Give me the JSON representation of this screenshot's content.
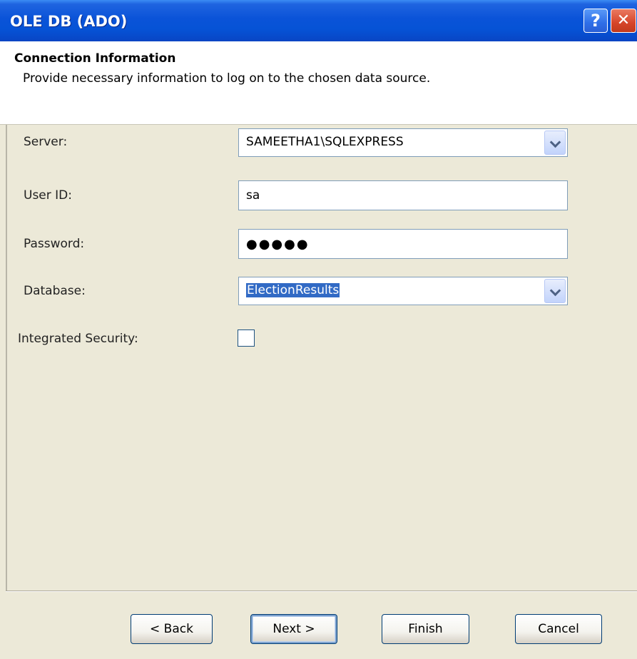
{
  "window": {
    "title": "OLE DB (ADO)",
    "help_label": "?",
    "close_label": "✕"
  },
  "header": {
    "title": "Connection Information",
    "subtitle": "Provide necessary information to log on to the chosen data source."
  },
  "form": {
    "server": {
      "label": "Server:",
      "value": "SAMEETHA1\\SQLEXPRESS"
    },
    "user_id": {
      "label": "User ID:",
      "value": "sa"
    },
    "password": {
      "label": "Password:",
      "value": "●●●●●"
    },
    "database": {
      "label": "Database:",
      "value": "ElectionResults"
    },
    "integrated_security": {
      "label": "Integrated Security:",
      "checked": false
    }
  },
  "buttons": {
    "back": "< Back",
    "next": "Next >",
    "finish": "Finish",
    "cancel": "Cancel"
  },
  "colors": {
    "titlebar": "#0653d6",
    "dialog_bg": "#ece9d8",
    "selection": "#316ac5"
  }
}
